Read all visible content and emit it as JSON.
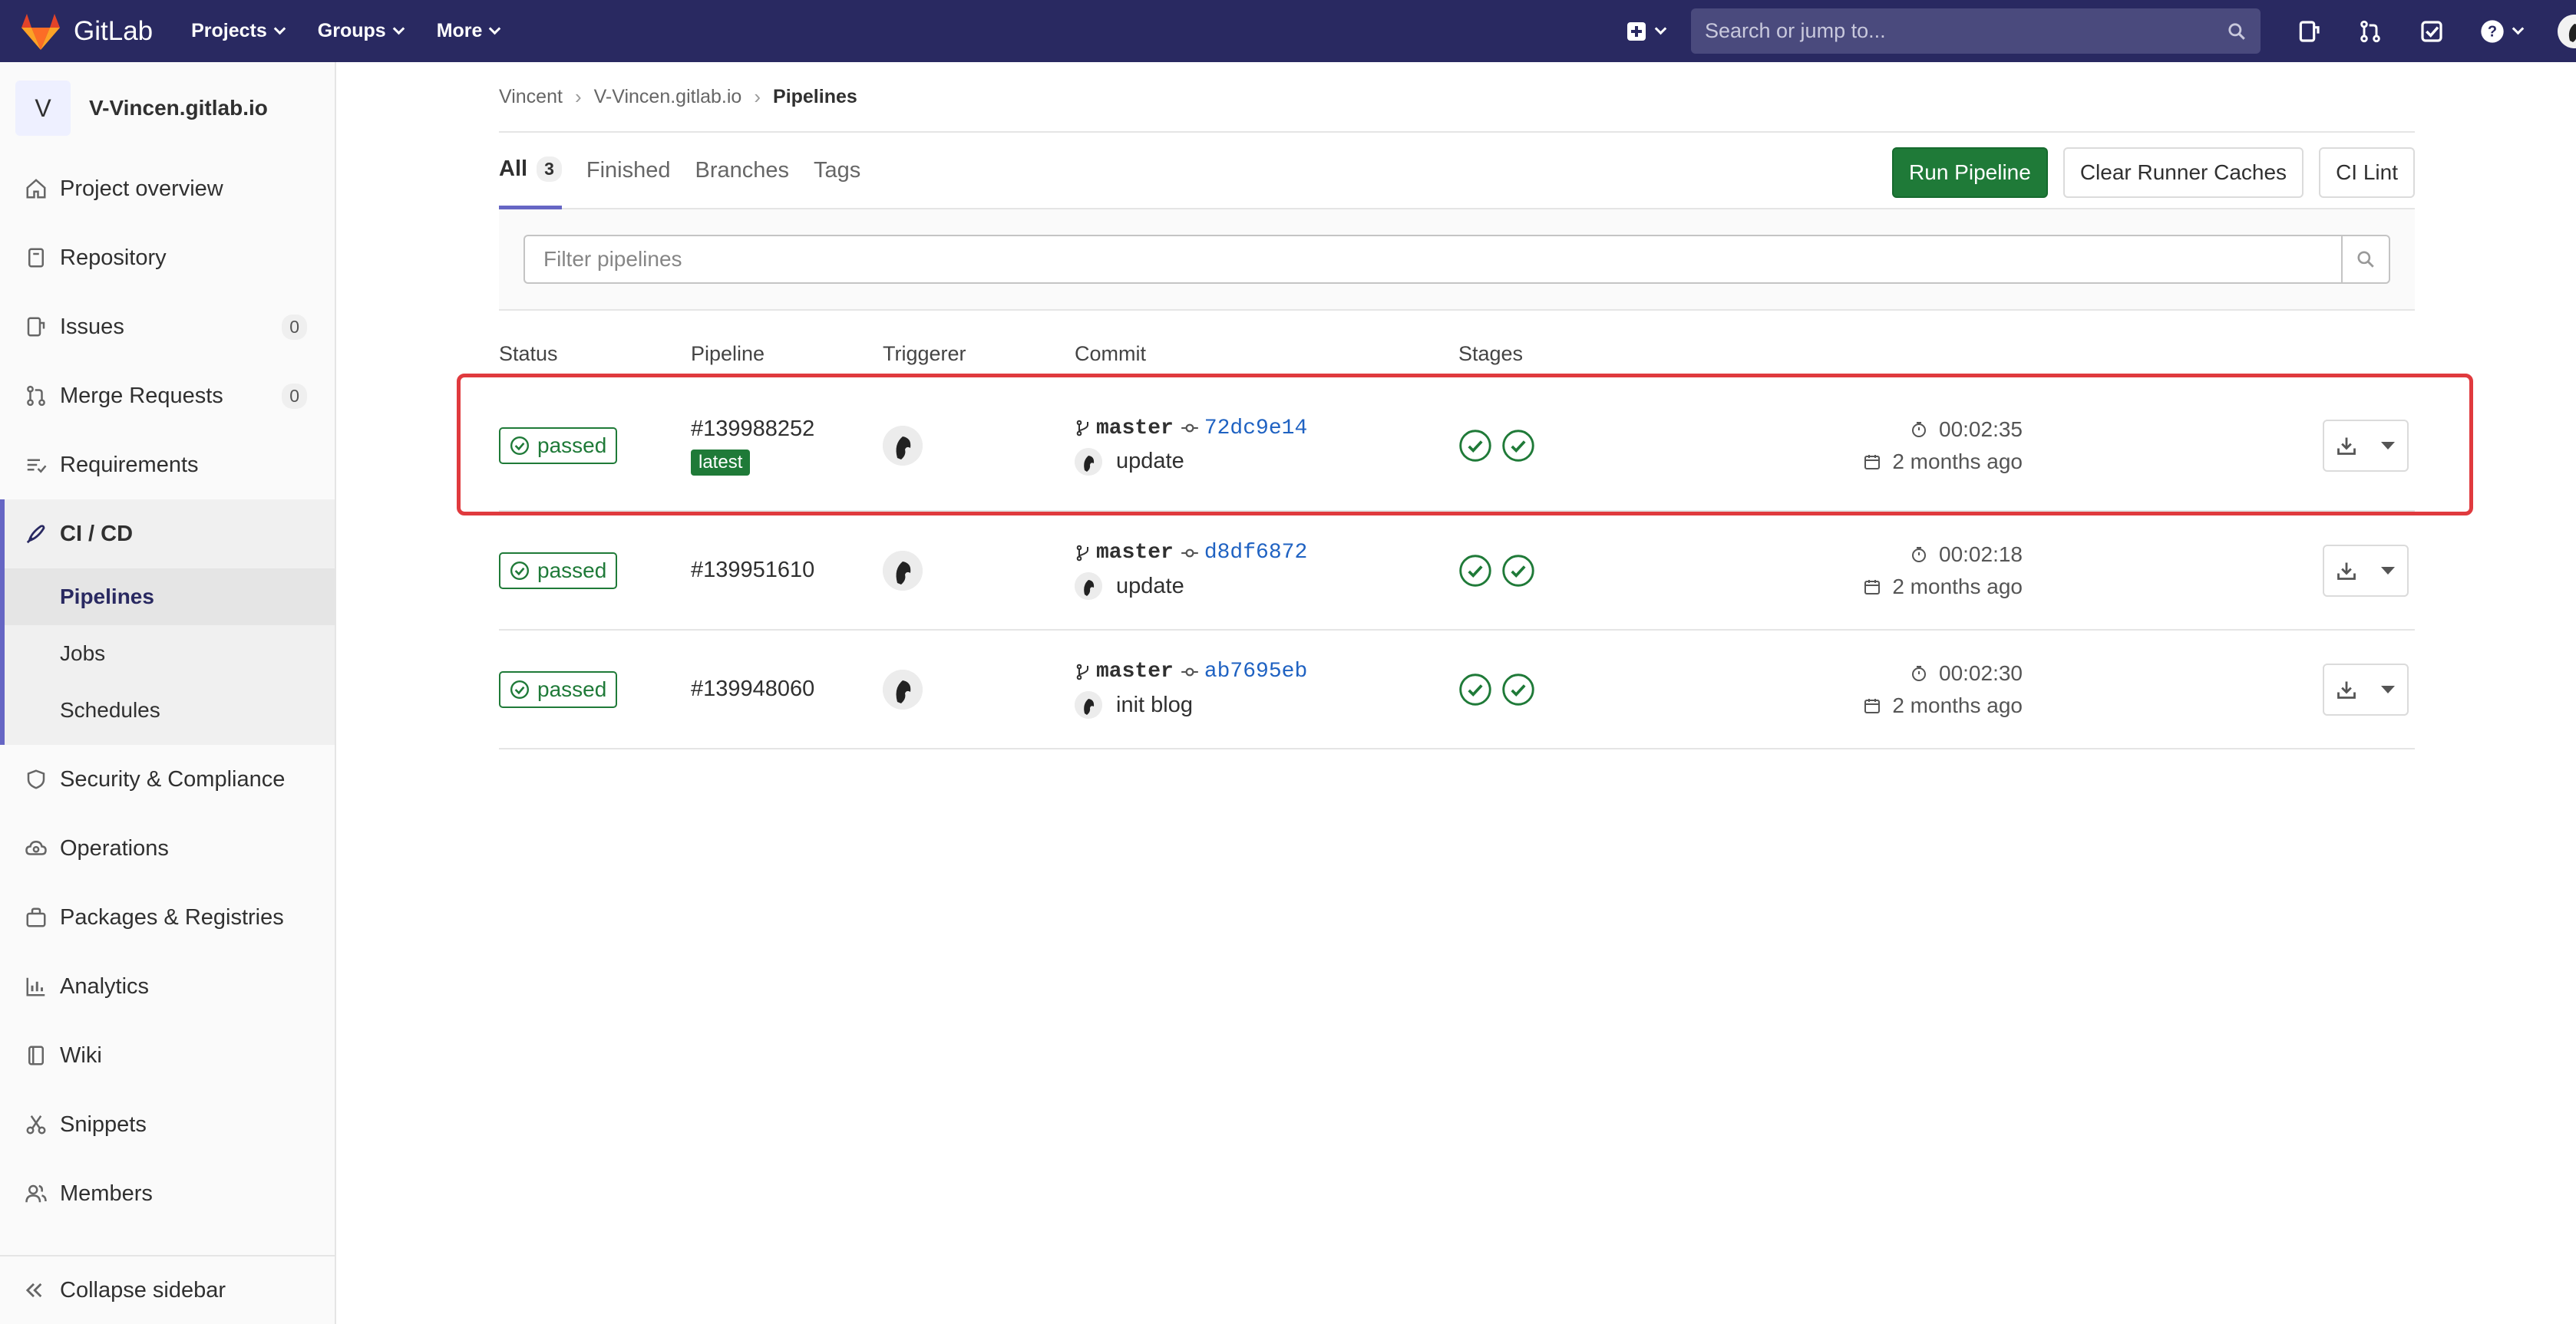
{
  "app": {
    "name": "GitLab"
  },
  "topnav": {
    "menus": [
      "Projects",
      "Groups",
      "More"
    ],
    "search_placeholder": "Search or jump to..."
  },
  "sidebar": {
    "project_initial": "V",
    "project_name": "V-Vincen.gitlab.io",
    "items": [
      {
        "label": "Project overview",
        "icon": "home-icon"
      },
      {
        "label": "Repository",
        "icon": "repository-icon"
      },
      {
        "label": "Issues",
        "icon": "issues-icon",
        "count": "0"
      },
      {
        "label": "Merge Requests",
        "icon": "merge-request-icon",
        "count": "0"
      },
      {
        "label": "Requirements",
        "icon": "requirements-icon"
      },
      {
        "label": "CI / CD",
        "icon": "rocket-icon",
        "active": true
      },
      {
        "label": "Security & Compliance",
        "icon": "shield-icon"
      },
      {
        "label": "Operations",
        "icon": "cloud-gear-icon"
      },
      {
        "label": "Packages & Registries",
        "icon": "package-icon"
      },
      {
        "label": "Analytics",
        "icon": "chart-icon"
      },
      {
        "label": "Wiki",
        "icon": "book-icon"
      },
      {
        "label": "Snippets",
        "icon": "scissors-icon"
      },
      {
        "label": "Members",
        "icon": "users-icon"
      }
    ],
    "cicd_sub": [
      "Pipelines",
      "Jobs",
      "Schedules"
    ],
    "collapse_label": "Collapse sidebar"
  },
  "breadcrumb": [
    "Vincent",
    "V-Vincen.gitlab.io",
    "Pipelines"
  ],
  "tabs": [
    {
      "label": "All",
      "count": "3"
    },
    {
      "label": "Finished"
    },
    {
      "label": "Branches"
    },
    {
      "label": "Tags"
    }
  ],
  "actions": {
    "run_pipeline": "Run Pipeline",
    "clear_caches": "Clear Runner Caches",
    "ci_lint": "CI Lint"
  },
  "filter_placeholder": "Filter pipelines",
  "table": {
    "headers": [
      "Status",
      "Pipeline",
      "Triggerer",
      "Commit",
      "Stages"
    ],
    "rows": [
      {
        "status": "passed",
        "id": "#139988252",
        "badge": "latest",
        "branch": "master",
        "sha": "72dc9e14",
        "message": "update",
        "duration": "00:02:35",
        "finished": "2 months ago"
      },
      {
        "status": "passed",
        "id": "#139951610",
        "badge": "",
        "branch": "master",
        "sha": "d8df6872",
        "message": "update",
        "duration": "00:02:18",
        "finished": "2 months ago"
      },
      {
        "status": "passed",
        "id": "#139948060",
        "badge": "",
        "branch": "master",
        "sha": "ab7695eb",
        "message": "init blog",
        "duration": "00:02:30",
        "finished": "2 months ago"
      }
    ]
  },
  "colors": {
    "navbar": "#292961",
    "success": "#1f7a38",
    "link": "#1f62c2",
    "accent": "#6666c4",
    "highlight": "#e03a3e"
  }
}
